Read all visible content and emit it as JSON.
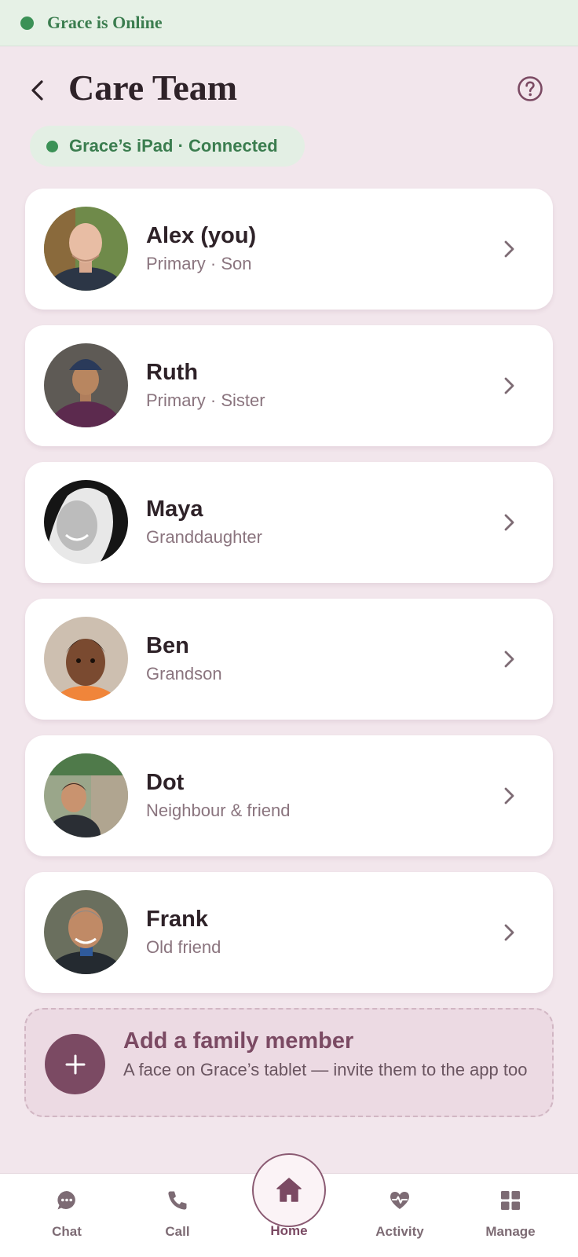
{
  "status_bar": {
    "text": "Grace is Online",
    "indicator_color": "#3b9156"
  },
  "header": {
    "title": "Care Team",
    "back_icon": "chevron-left-icon",
    "help_icon": "question-circle-icon"
  },
  "device": {
    "text": "Grace’s iPad · Connected",
    "indicator_color": "#3b9156"
  },
  "members": [
    {
      "name": "Alex (you)",
      "role": "Primary · Son"
    },
    {
      "name": "Ruth",
      "role": "Primary · Sister"
    },
    {
      "name": "Maya",
      "role": "Granddaughter"
    },
    {
      "name": "Ben",
      "role": "Grandson"
    },
    {
      "name": "Dot",
      "role": "Neighbour & friend"
    },
    {
      "name": "Frank",
      "role": "Old friend"
    }
  ],
  "add_member": {
    "title": "Add a family member",
    "subtitle": "A face on Grace’s tablet — invite them to the app too",
    "icon": "plus-icon"
  },
  "tabs": [
    {
      "label": "Chat",
      "icon": "chat-bubble-icon"
    },
    {
      "label": "Call",
      "icon": "phone-icon"
    },
    {
      "label": "Home",
      "icon": "home-icon",
      "active": true
    },
    {
      "label": "Activity",
      "icon": "heart-pulse-icon"
    },
    {
      "label": "Manage",
      "icon": "grid-icon"
    }
  ],
  "colors": {
    "accent": "#7b4a63",
    "online_green": "#3b9156",
    "background": "#f2e6ec"
  }
}
